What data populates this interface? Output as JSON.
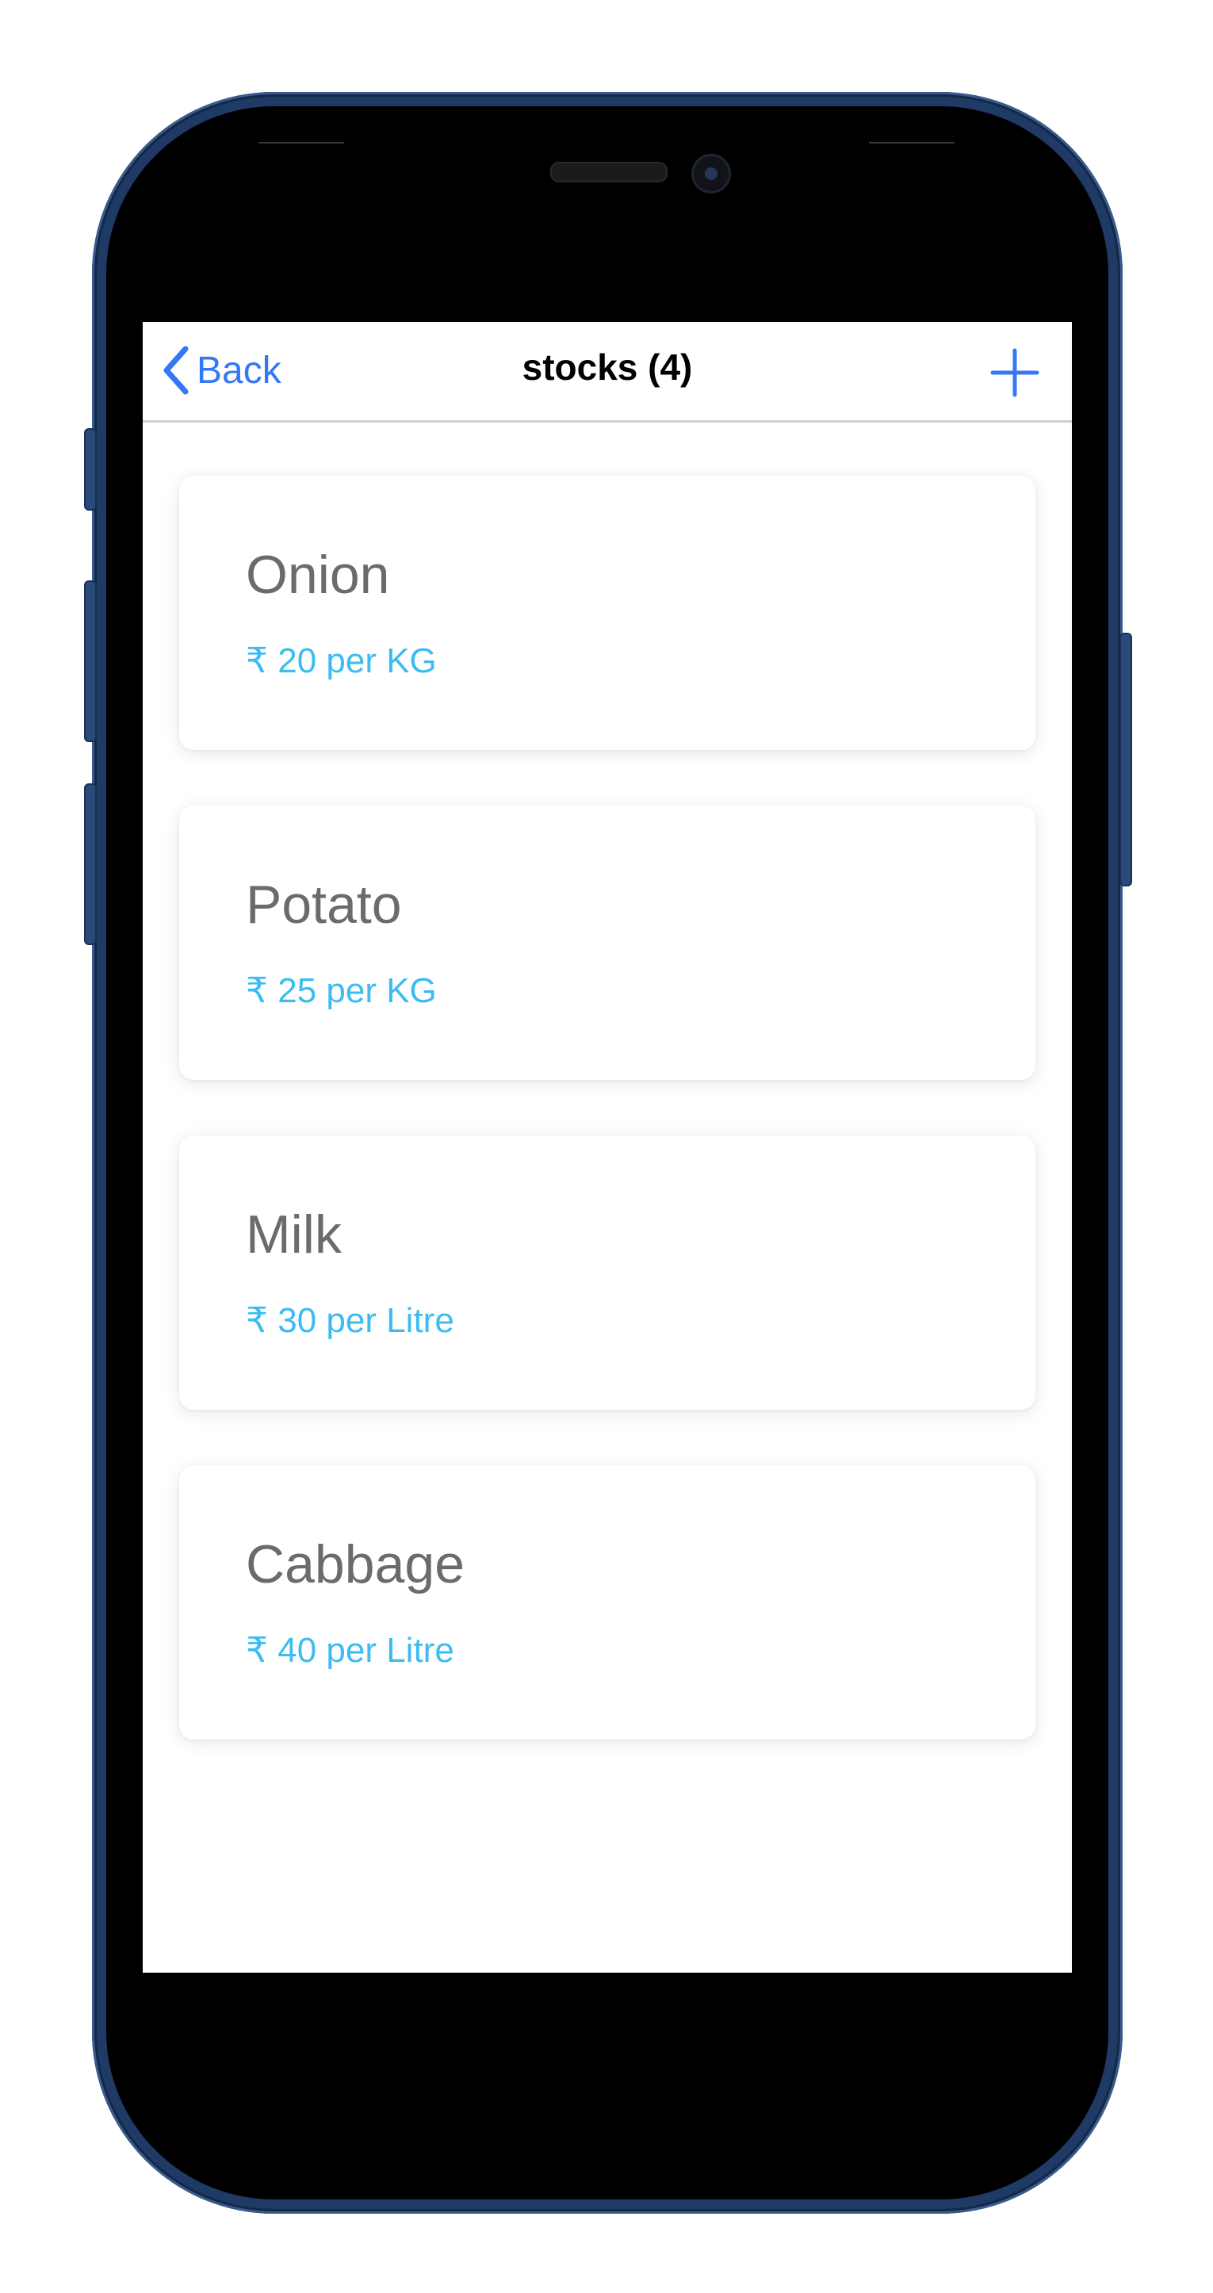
{
  "navbar": {
    "back_label": "Back",
    "title": "stocks (4)",
    "add_icon": "plus-icon",
    "back_icon": "chevron-left-icon"
  },
  "stocks": [
    {
      "name": "Onion",
      "price": "₹ 20 per KG"
    },
    {
      "name": "Potato",
      "price": "₹ 25 per KG"
    },
    {
      "name": "Milk",
      "price": "₹ 30 per Litre"
    },
    {
      "name": "Cabbage",
      "price": "₹ 40 per Litre"
    }
  ],
  "colors": {
    "accent": "#3478f6",
    "price": "#3cbcf0",
    "item_name": "#6b6b6b",
    "phone_frame": "#1f3a64"
  }
}
